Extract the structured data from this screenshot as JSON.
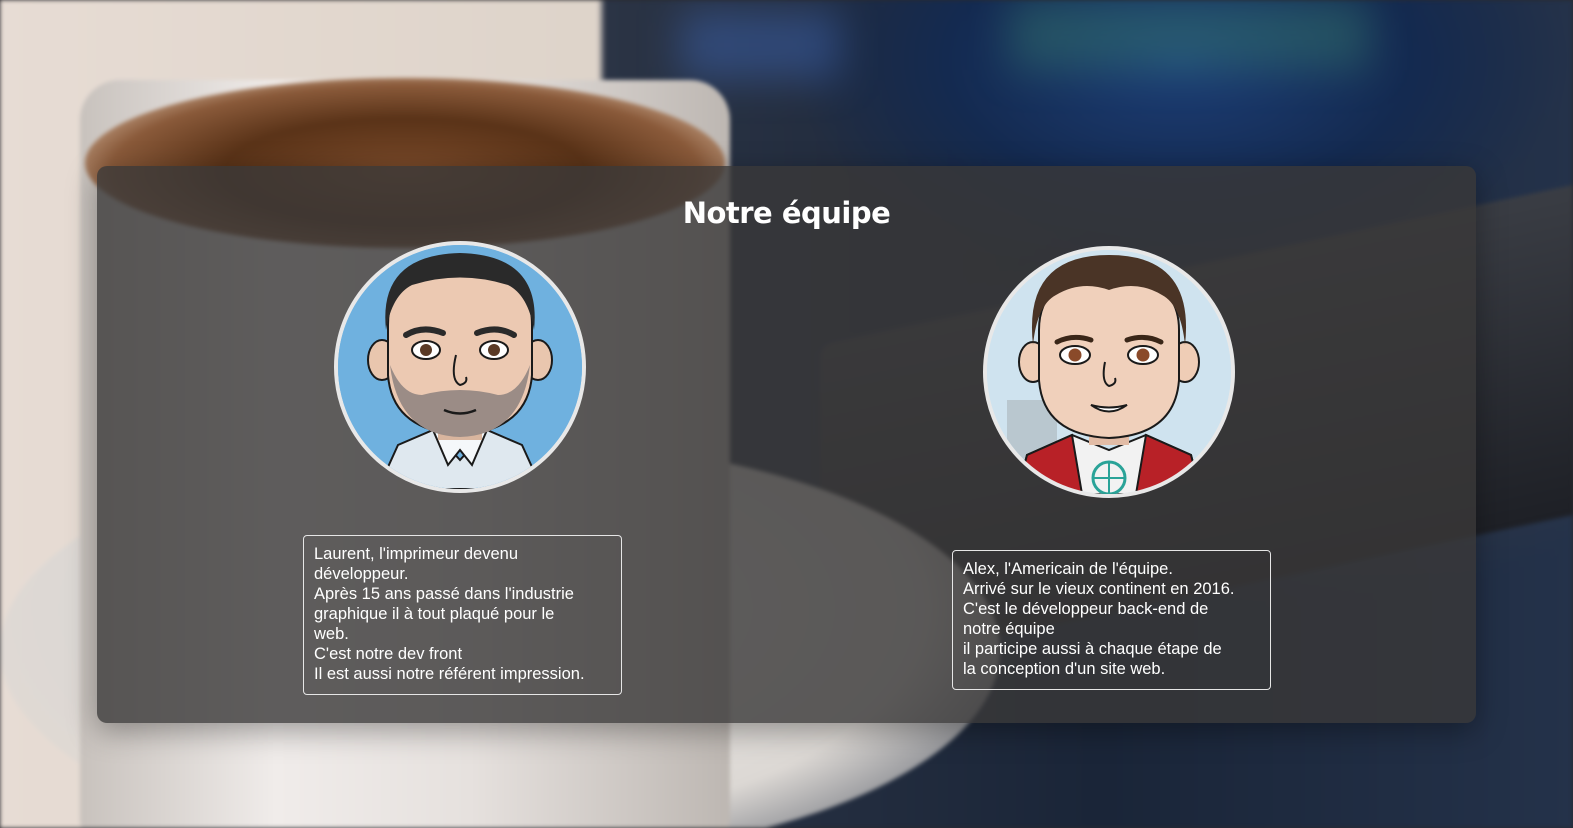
{
  "section": {
    "title": "Notre équipe"
  },
  "members": [
    {
      "avatar_icon": "cartoon-avatar-bearded-man",
      "bio_lines": [
        "Laurent, l'imprimeur devenu",
        "développeur.",
        "Après 15 ans passé dans l'industrie",
        "graphique il à tout plaqué pour le",
        "web.",
        "C'est notre dev front",
        "Il est aussi notre référent impression."
      ]
    },
    {
      "avatar_icon": "cartoon-avatar-young-man",
      "bio_lines": [
        "Alex, l'Americain de l'équipe.",
        "Arrivé sur le vieux continent en 2016.",
        "C'est le développeur back-end de",
        "notre équipe",
        "il participe aussi à chaque étape de",
        "la conception d'un site web."
      ]
    }
  ]
}
